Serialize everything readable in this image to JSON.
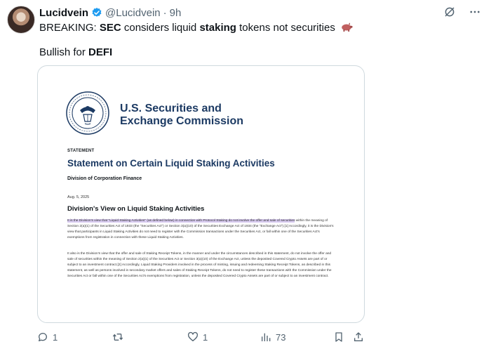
{
  "tweet": {
    "author_name": "Lucidvein",
    "handle": "@Lucidvein",
    "separator": "·",
    "time": "9h",
    "text_line1": {
      "prefix": "BREAKING: ",
      "sec": "SEC",
      "mid1": " considers liquid ",
      "staking": "staking",
      "rest": " tokens not securities"
    },
    "text_line2": {
      "prefix": "Bullish for ",
      "defi": "DEFI"
    },
    "emoji_icon": "pig-emoji-icon"
  },
  "document": {
    "seal_icon": "sec-seal-icon",
    "agency_line1": "U.S. Securities and",
    "agency_line2": "Exchange Commission",
    "statement_label": "STATEMENT",
    "title": "Statement on Certain Liquid Staking Activities",
    "division": "Division of Corporation Finance",
    "date": "Aug. 5, 2025",
    "section_heading": "Division's View on Liquid Staking Activities",
    "para1_highlight": "It is the Division's view that \"Liquid Staking Activities\" (as defined below) in connection with Protocol Staking do not involve the offer and sale of securities",
    "para1_rest": " within the meaning of Section 2(a)(1) of the Securities Act of 1933 (the \"Securities Act\") or Section 3(a)(10) of the Securities Exchange Act of 1934 (the \"Exchange Act\").[1] Accordingly, it is the Division's view that participants in Liquid Staking Activities do not need to register with the Commission transactions under the Securities Act, or fall within one of the Securities Act's exemptions from registration in connection with these Liquid Staking Activities.",
    "para2": "It also is the Division's view that the offer and sale of Staking Receipt Tokens, in the manner and under the circumstances described in this statement, do not involve the offer and sale of securities within the meaning of Section 2(a)(1) of the Securities Act or Section 3(a)(10) of the Exchange Act, unless the deposited Covered Crypto Assets are part of or subject to an investment contract.[2] Accordingly, Liquid Staking Providers involved in the process of minting, issuing and redeeming Staking Receipt Tokens, as described in this statement, as well as persons involved in secondary market offers and sales of Staking Receipt Tokens, do not need to register these transactions with the Commission under the Securities Act or fall within one of the Securities Act's exemptions from registration, unless the deposited Covered Crypto Assets are part of or subject to an investment contract."
  },
  "actions": {
    "reply_count": "1",
    "repost_count": "",
    "like_count": "1",
    "views_count": "73"
  },
  "colors": {
    "verified": "#1d9bf0",
    "sec_blue": "#1c3a63",
    "highlight": "#d9ccf1",
    "muted": "#536471"
  }
}
